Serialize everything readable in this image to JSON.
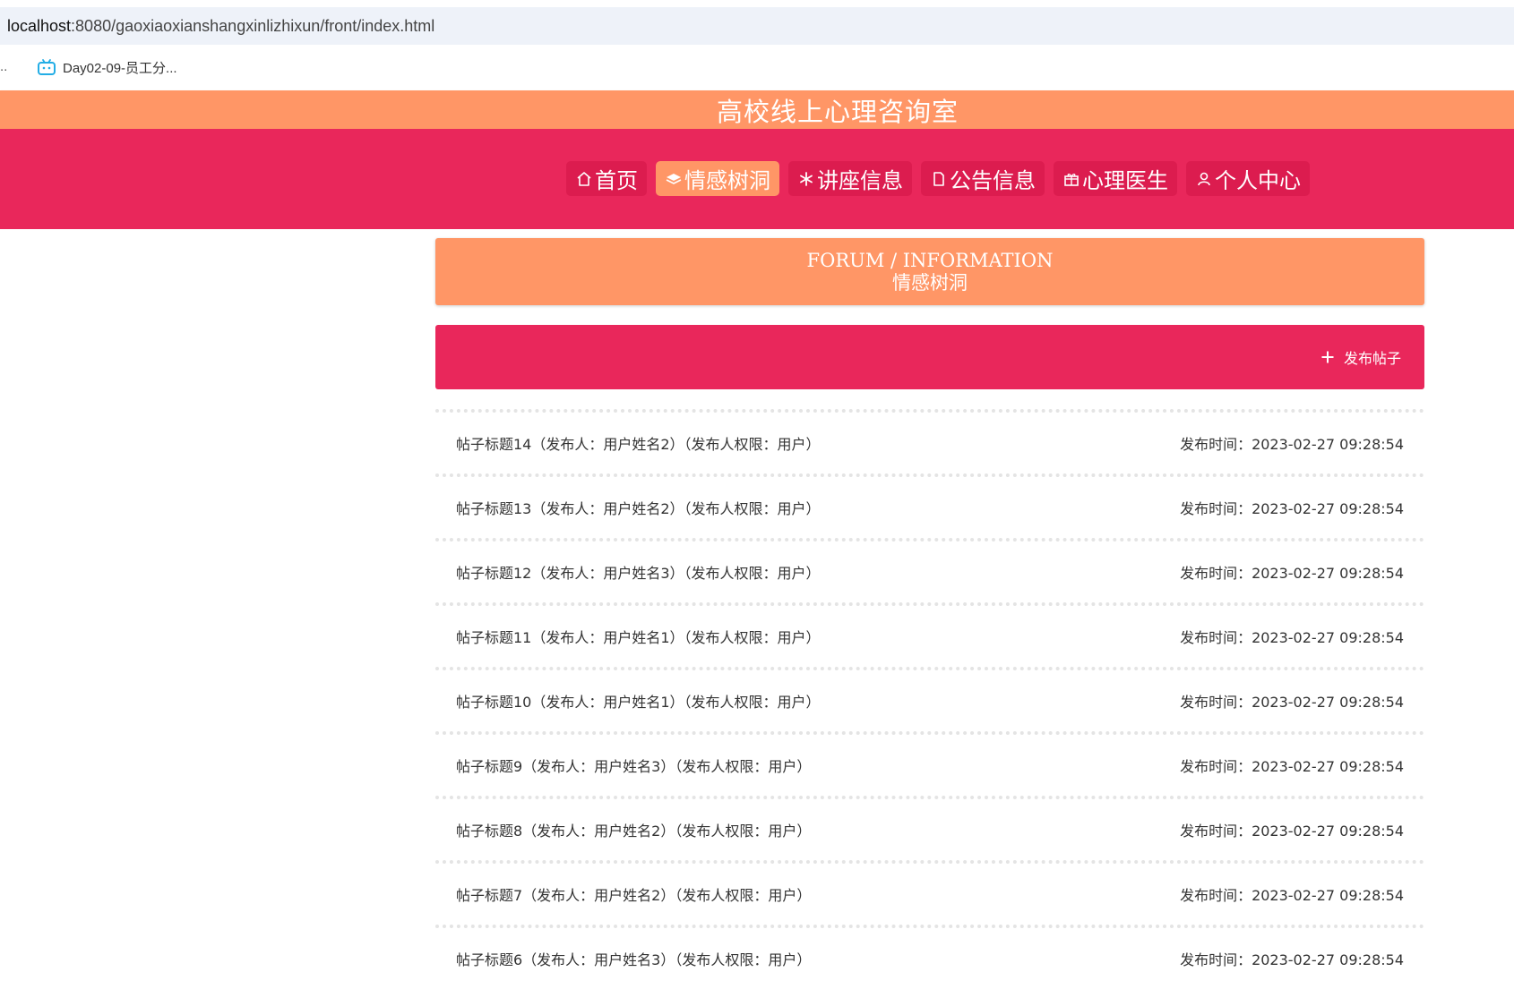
{
  "browser": {
    "url_host": "localhost",
    "url_path": ":8080/gaoxiaoxianshangxinlizhixun/front/index.html",
    "bookmarks_left_ellipsis": "..",
    "bookmark_label": "Day02-09-员工分..."
  },
  "site": {
    "title": "高校线上心理咨询室"
  },
  "nav": {
    "items": [
      {
        "label": "首页",
        "icon": "home-icon"
      },
      {
        "label": "情感树洞",
        "icon": "layers-icon",
        "active": true
      },
      {
        "label": "讲座信息",
        "icon": "snowflake-icon"
      },
      {
        "label": "公告信息",
        "icon": "document-icon"
      },
      {
        "label": "心理医生",
        "icon": "gift-icon"
      },
      {
        "label": "个人中心",
        "icon": "user-icon"
      }
    ]
  },
  "section": {
    "en_title": "FORUM / INFORMATION",
    "cn_title": "情感树洞"
  },
  "actions": {
    "publish_label": "发布帖子"
  },
  "posts": [
    {
      "title": "帖子标题14（发布人：用户姓名2）（发布人权限：用户）",
      "time": "发布时间：2023-02-27 09:28:54"
    },
    {
      "title": "帖子标题13（发布人：用户姓名2）（发布人权限：用户）",
      "time": "发布时间：2023-02-27 09:28:54"
    },
    {
      "title": "帖子标题12（发布人：用户姓名3）（发布人权限：用户）",
      "time": "发布时间：2023-02-27 09:28:54"
    },
    {
      "title": "帖子标题11（发布人：用户姓名1）（发布人权限：用户）",
      "time": "发布时间：2023-02-27 09:28:54"
    },
    {
      "title": "帖子标题10（发布人：用户姓名1）（发布人权限：用户）",
      "time": "发布时间：2023-02-27 09:28:54"
    },
    {
      "title": "帖子标题9（发布人：用户姓名3）（发布人权限：用户）",
      "time": "发布时间：2023-02-27 09:28:54"
    },
    {
      "title": "帖子标题8（发布人：用户姓名2）（发布人权限：用户）",
      "time": "发布时间：2023-02-27 09:28:54"
    },
    {
      "title": "帖子标题7（发布人：用户姓名2）（发布人权限：用户）",
      "time": "发布时间：2023-02-27 09:28:54"
    },
    {
      "title": "帖子标题6（发布人：用户姓名3）（发布人权限：用户）",
      "time": "发布时间：2023-02-27 09:28:54"
    }
  ],
  "colors": {
    "title_bar": "#ff9666",
    "nav_bar": "#e9275b",
    "active_nav": "#ff9666"
  }
}
